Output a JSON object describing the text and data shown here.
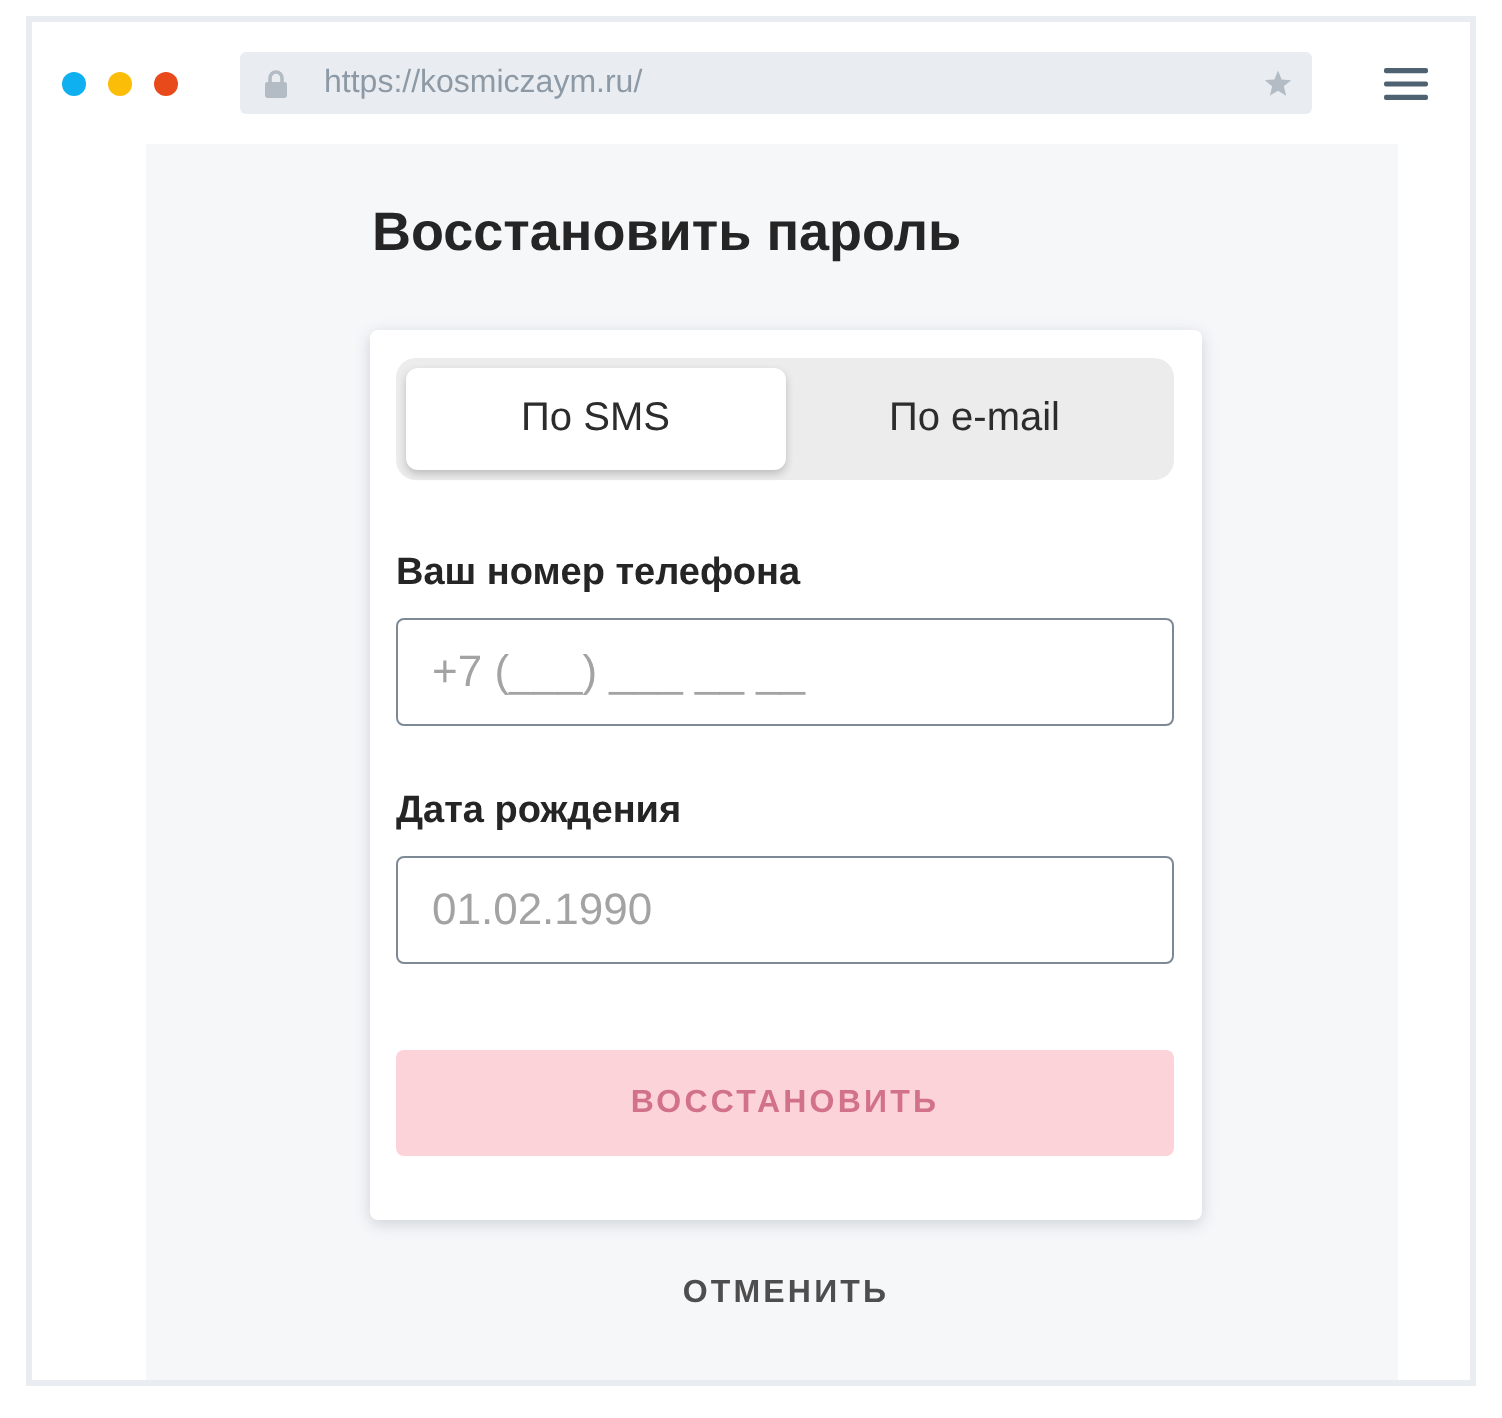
{
  "browser": {
    "window_dots": [
      {
        "color": "#0fb0f0"
      },
      {
        "color": "#fbbd08"
      },
      {
        "color": "#e84a1c"
      }
    ],
    "url": "https://kosmiczaym.ru/"
  },
  "title": "Восстановить пароль",
  "tabs": [
    {
      "label": "По SMS",
      "selected": true
    },
    {
      "label": "По e-mail",
      "selected": false
    }
  ],
  "fields": [
    {
      "label": "Ваш номер телефона",
      "placeholder": "+7 (___) ___ __ __"
    },
    {
      "label": "Дата рождения",
      "placeholder": "01.02.1990"
    }
  ],
  "submit_button": {
    "label": "ВОССТАНОВИТЬ",
    "disabled": true
  },
  "cancel_link": "ОТМЕНИТЬ"
}
